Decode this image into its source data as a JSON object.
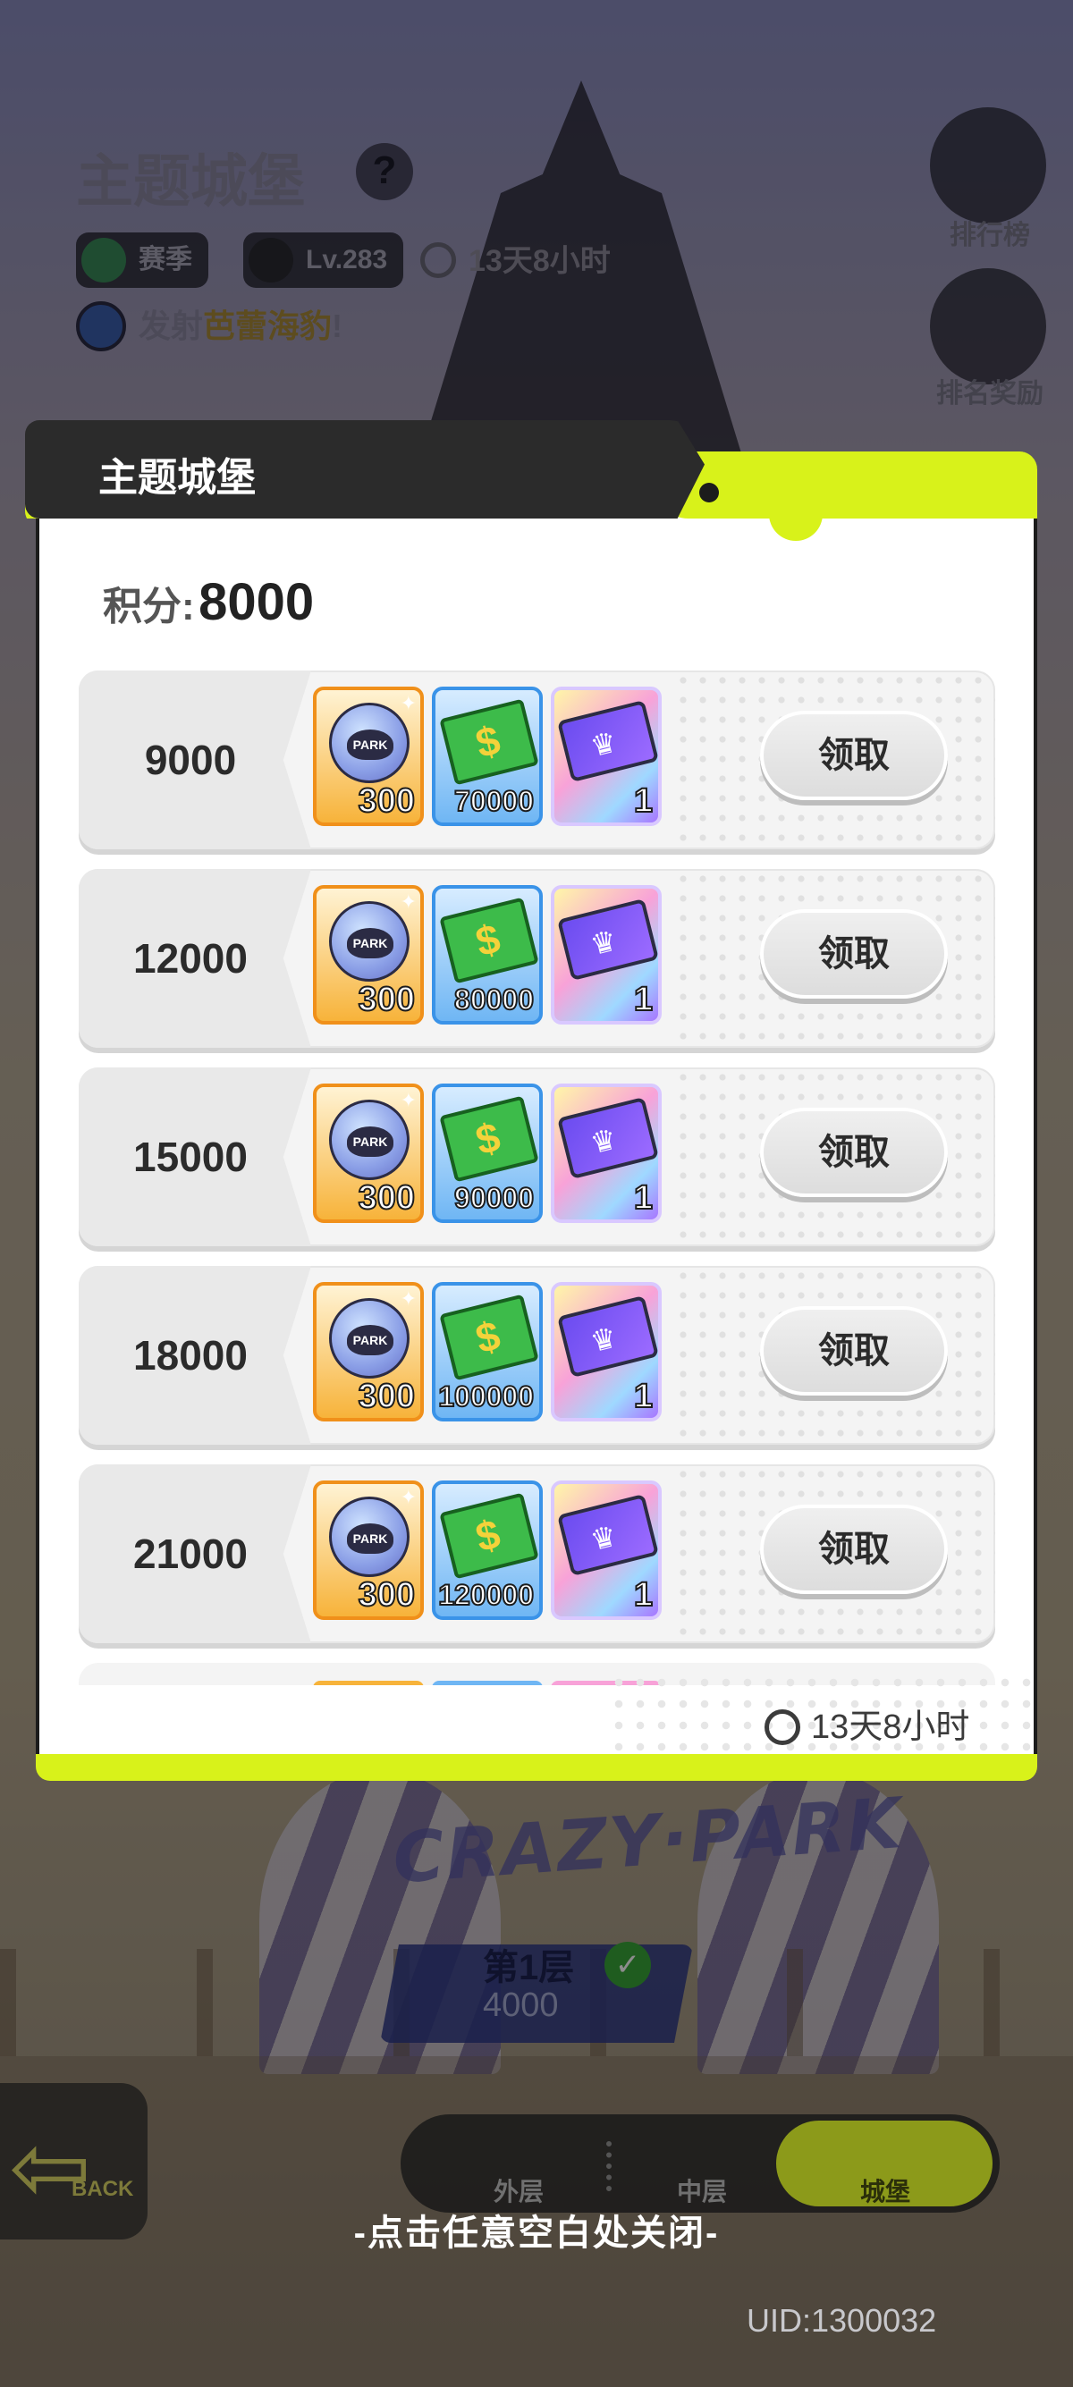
{
  "header": {
    "title": "主题城堡",
    "help_symbol": "?",
    "season_label": "赛季",
    "level_label": "Lv.283",
    "timer": "13天8小时",
    "launch_prefix": "发射",
    "launch_target": "芭蕾海豹",
    "launch_suffix": "!"
  },
  "side_buttons": [
    {
      "label": "排行榜",
      "icon": "trophy-icon"
    },
    {
      "label": "排名奖励",
      "icon": "reward-icon"
    }
  ],
  "modal": {
    "title": "主题城堡",
    "score_label": "积分:",
    "score_value": "8000",
    "claim_label": "领取",
    "timer": "13天8小时",
    "rows": [
      {
        "threshold": "9000",
        "items": [
          {
            "type": "park-coin",
            "qty": "300"
          },
          {
            "type": "cash",
            "qty": "70000"
          },
          {
            "type": "ticket",
            "qty": "1"
          }
        ]
      },
      {
        "threshold": "12000",
        "items": [
          {
            "type": "park-coin",
            "qty": "300"
          },
          {
            "type": "cash",
            "qty": "80000"
          },
          {
            "type": "ticket",
            "qty": "1"
          }
        ]
      },
      {
        "threshold": "15000",
        "items": [
          {
            "type": "park-coin",
            "qty": "300"
          },
          {
            "type": "cash",
            "qty": "90000"
          },
          {
            "type": "ticket",
            "qty": "1"
          }
        ]
      },
      {
        "threshold": "18000",
        "items": [
          {
            "type": "park-coin",
            "qty": "300"
          },
          {
            "type": "cash",
            "qty": "100000"
          },
          {
            "type": "ticket",
            "qty": "1"
          }
        ]
      },
      {
        "threshold": "21000",
        "items": [
          {
            "type": "park-coin",
            "qty": "300"
          },
          {
            "type": "cash",
            "qty": "120000"
          },
          {
            "type": "ticket",
            "qty": "1"
          }
        ]
      }
    ]
  },
  "background": {
    "logo_text": "CRAZY·PARK",
    "floor_label": "第1层",
    "floor_score": "4000"
  },
  "bottom_nav": {
    "back_label": "BACK",
    "tabs": [
      "外层",
      "中层",
      "城堡"
    ],
    "active_tab": "城堡"
  },
  "close_hint": "-点击任意空白处关闭-",
  "uid": "UID:1300032",
  "colors": {
    "accent_lime": "#d8f21a",
    "dark_header": "#2b2b2b",
    "park_border": "#f0901a",
    "cash_border": "#3a93e8"
  }
}
